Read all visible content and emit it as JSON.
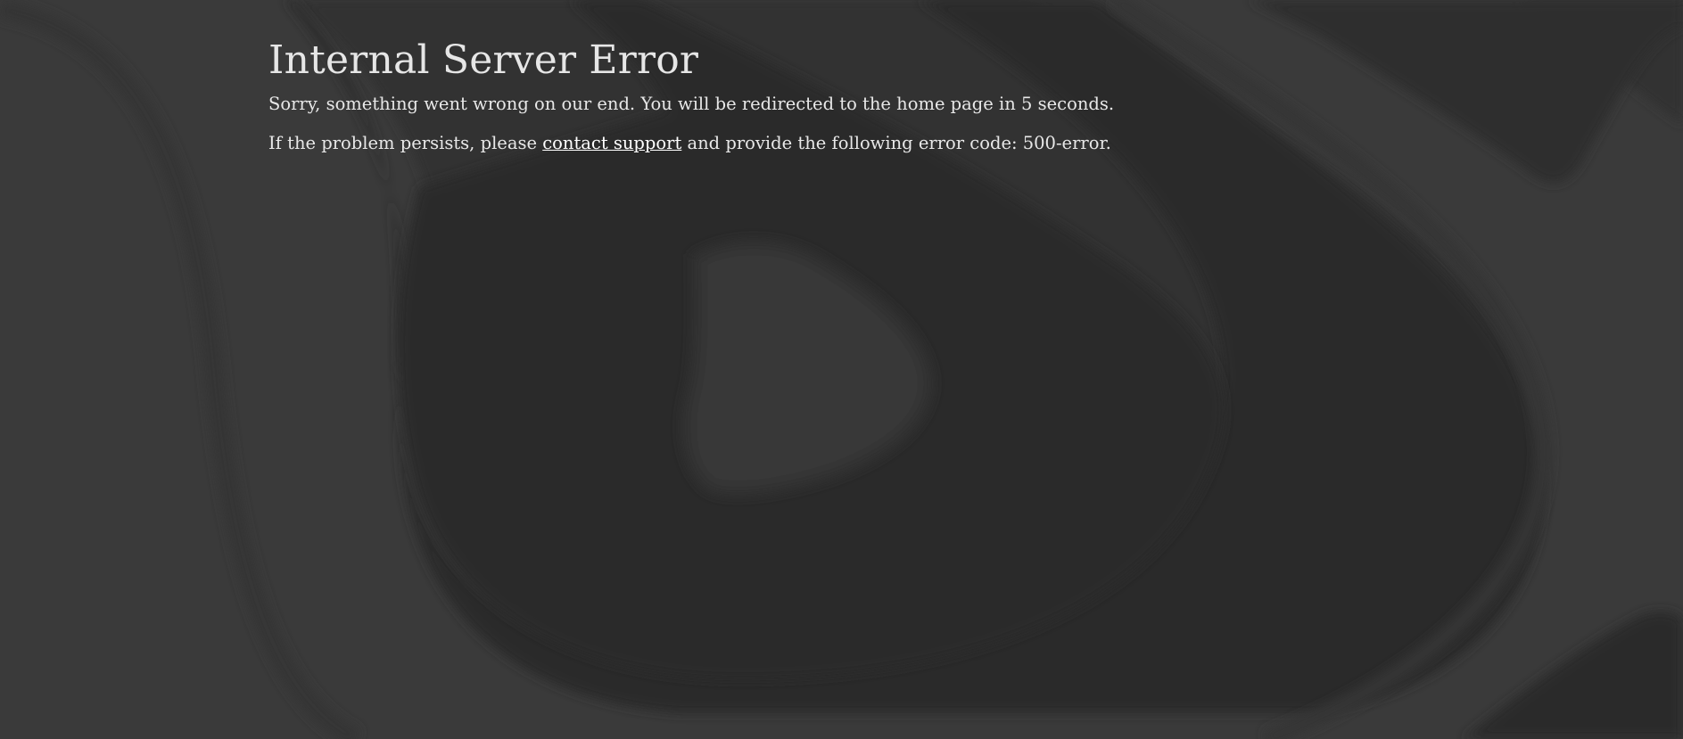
{
  "page": {
    "title": "Internal Server Error",
    "redirect_message": "Sorry, something went wrong on our end. You will be redirected to the home page in 5 seconds.",
    "support_prefix": "If the problem persists, please ",
    "support_link_label": "contact support",
    "support_suffix": " and provide the following error code: 500-error."
  },
  "colors": {
    "background_light": "#3b3b3b",
    "background_dark": "#2a2a2a",
    "text": "#e8e8e8",
    "link": "#ffffff"
  }
}
